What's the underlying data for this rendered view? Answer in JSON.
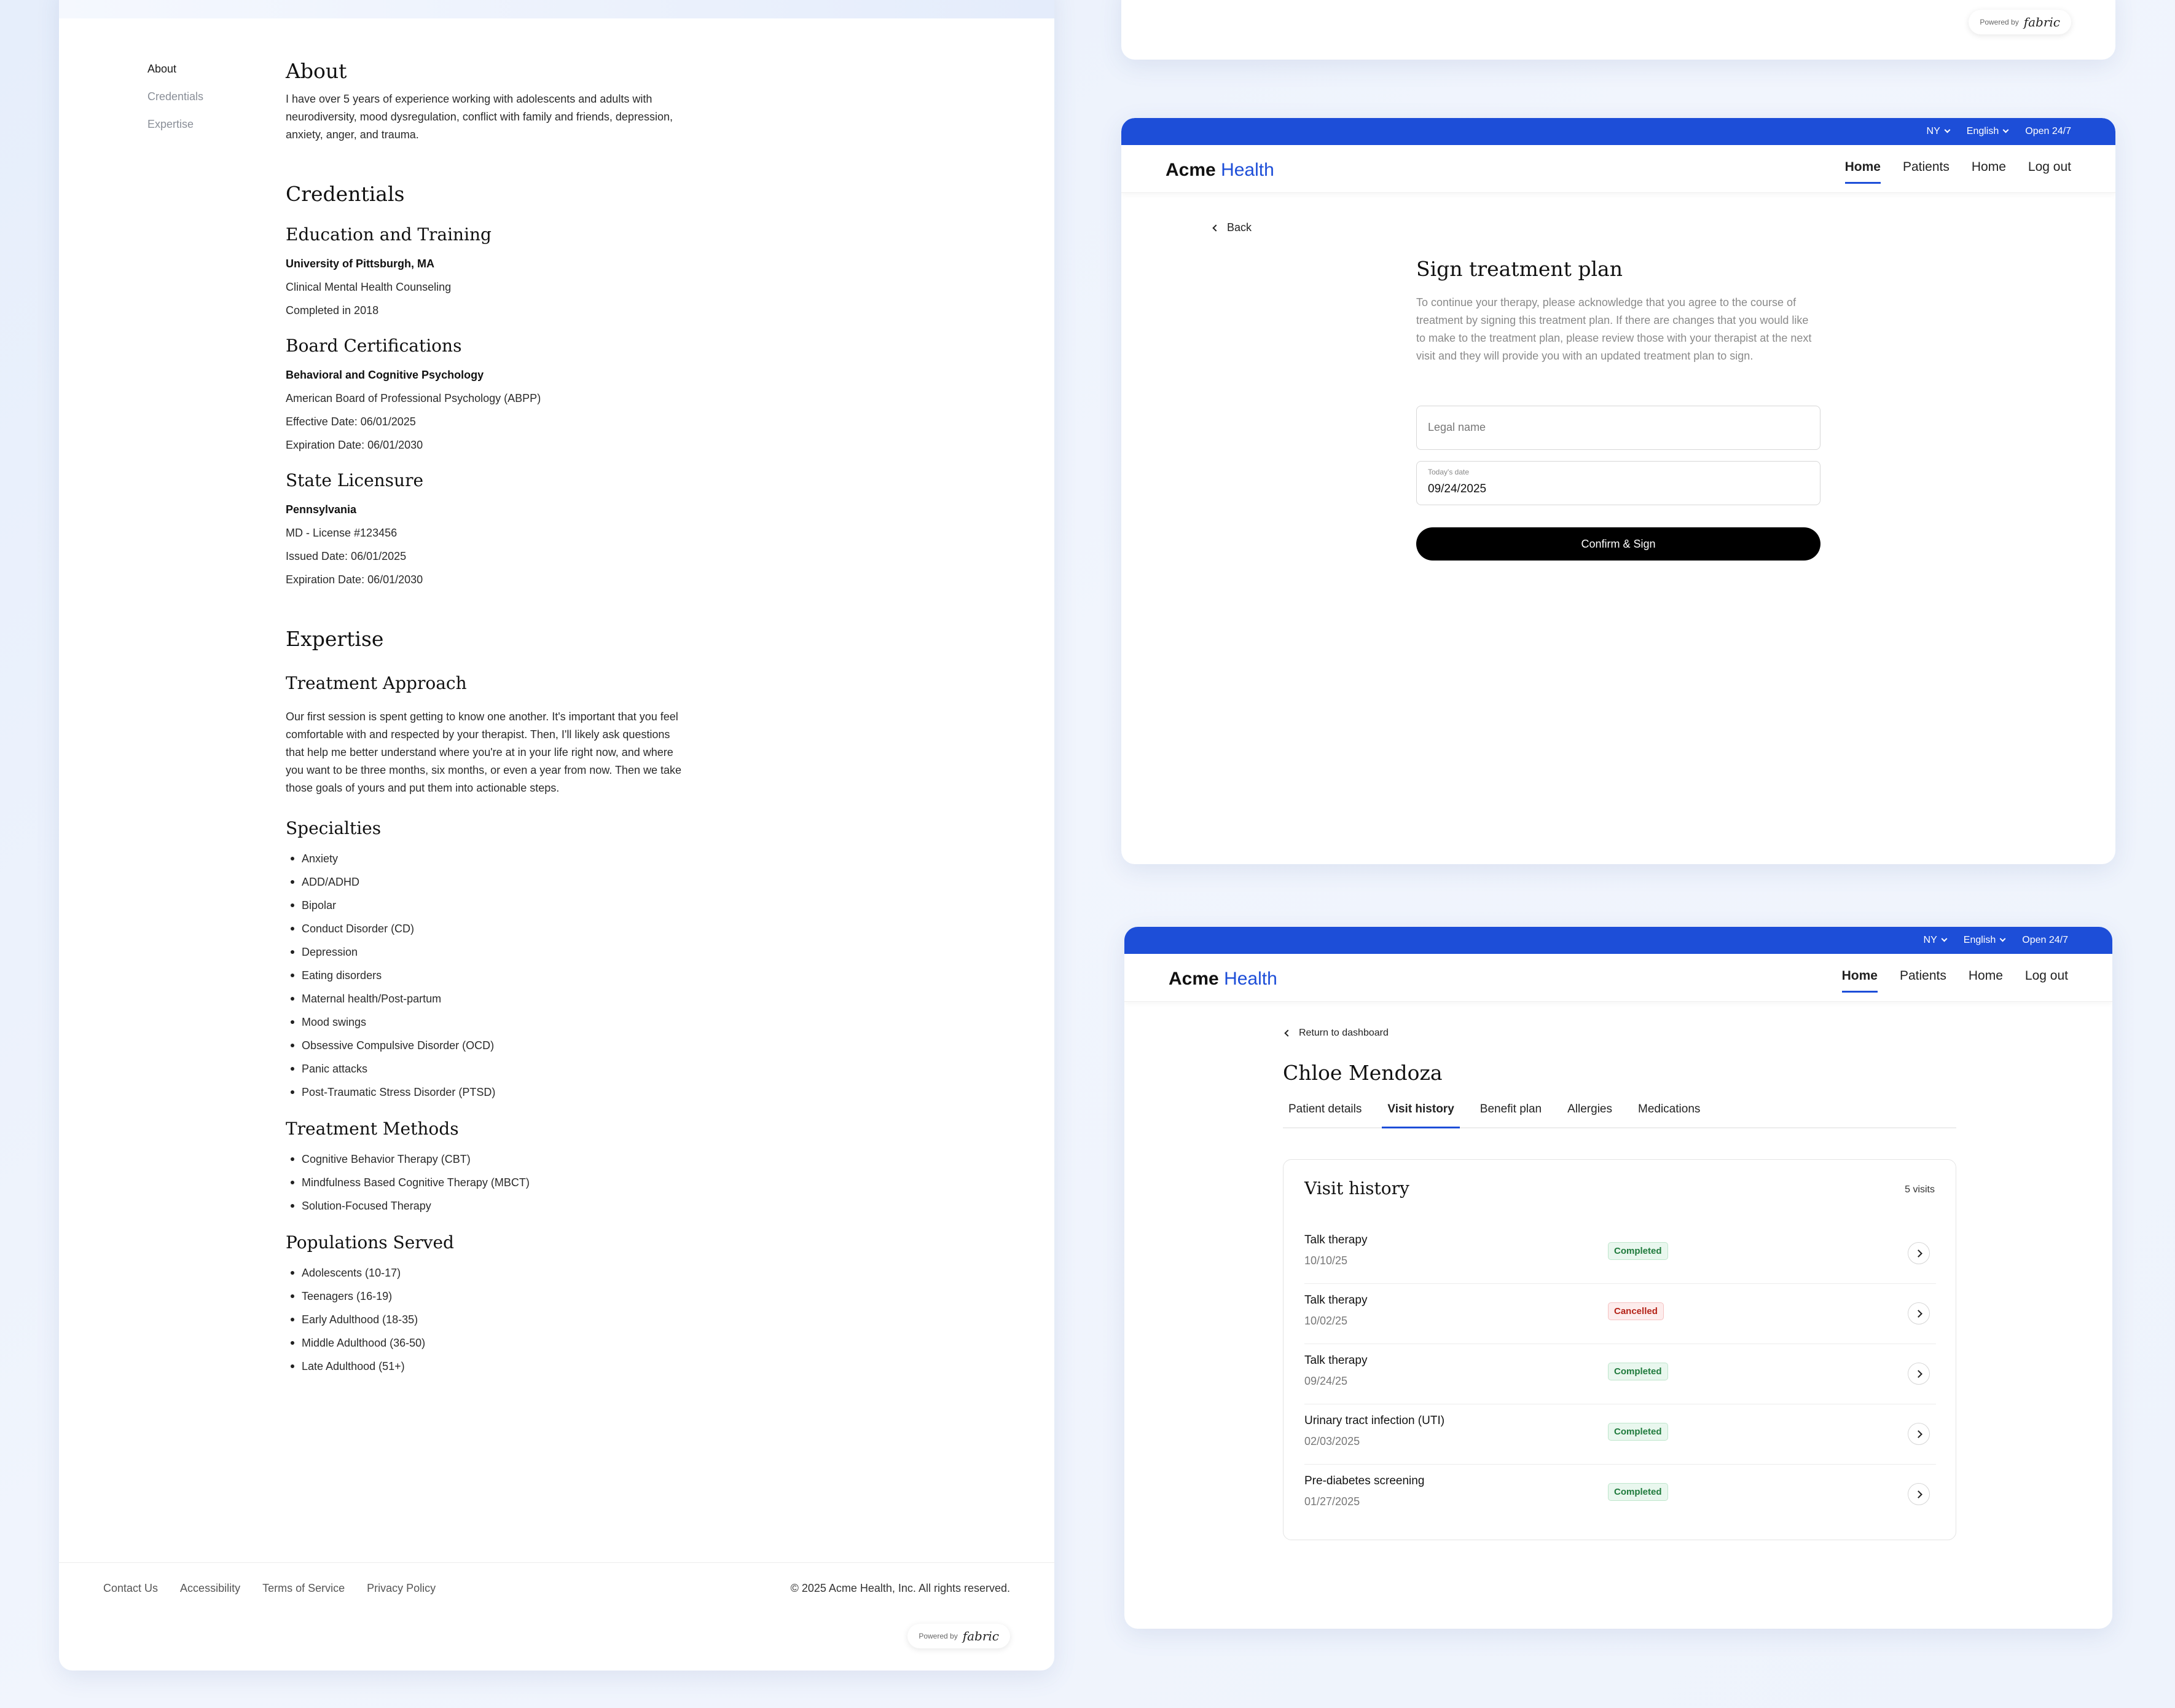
{
  "profile": {
    "nav": [
      "About",
      "Credentials",
      "Expertise"
    ],
    "about_title": "About",
    "about_text": "I have over 5 years of experience working with adolescents and adults with neurodiversity, mood dysregulation, conflict with family and friends, depression, anxiety, anger, and trauma.",
    "credentials_title": "Credentials",
    "education_title": "Education and Training",
    "education": [
      "University of Pittsburgh, MA",
      "Clinical Mental Health Counseling",
      "Completed in 2018"
    ],
    "board_title": "Board Certifications",
    "board": [
      "Behavioral and Cognitive Psychology",
      "American Board of Professional Psychology (ABPP)",
      "Effective Date: 06/01/2025",
      "Expiration Date: 06/01/2030"
    ],
    "licensure_title": "State Licensure",
    "licensure": [
      "Pennsylvania",
      "MD - License #123456",
      "Issued Date: 06/01/2025",
      "Expiration Date: 06/01/2030"
    ],
    "expertise_title": "Expertise",
    "approach_title": "Treatment Approach",
    "approach_text": "Our first session is spent getting to know one another. It's important that you feel comfortable with and respected by your therapist. Then, I'll likely ask questions that help me better understand where you're at in your life right now, and where you want to be three months, six months, or even a year from now. Then we take those goals of yours and put them into actionable steps.",
    "specialties_title": "Specialties",
    "specialties": [
      "Anxiety",
      "ADD/ADHD",
      "Bipolar",
      "Conduct Disorder (CD)",
      "Depression",
      "Eating disorders",
      "Maternal health/Post-partum",
      "Mood swings",
      "Obsessive Compulsive Disorder (OCD)",
      "Panic attacks",
      "Post-Traumatic Stress Disorder (PTSD)"
    ],
    "methods_title": "Treatment Methods",
    "methods": [
      "Cognitive Behavior Therapy (CBT)",
      "Mindfulness Based Cognitive Therapy (MBCT)",
      "Solution-Focused Therapy"
    ],
    "populations_title": "Populations Served",
    "populations": [
      "Adolescents (10-17)",
      "Teenagers (16-19)",
      "Early Adulthood (18-35)",
      "Middle Adulthood (36-50)",
      "Late Adulthood (51+)"
    ],
    "footer_links": [
      "Contact Us",
      "Accessibility",
      "Terms of Service",
      "Privacy Policy"
    ],
    "copyright": "© 2025 Acme Health, Inc. All rights reserved."
  },
  "powered": {
    "prefix": "Powered by",
    "brand": "fabric"
  },
  "header": {
    "region": "NY",
    "language": "English",
    "hours": "Open 24/7",
    "logo_bold": "Acme",
    "logo_rest": "Health",
    "nav": [
      "Home",
      "Patients",
      "Home",
      "Log out"
    ]
  },
  "sign": {
    "back": "Back",
    "title": "Sign treatment plan",
    "description": "To continue your therapy, please acknowledge that you agree to the course of treatment by signing this treatment plan. If there are changes that you would like to make to the treatment plan, please review those with your therapist at the next visit and they will provide you with an updated treatment plan to sign.",
    "legal_name_placeholder": "Legal name",
    "date_label": "Today's date",
    "date_value": "09/24/2025",
    "confirm": "Confirm & Sign"
  },
  "patient": {
    "back": "Return to dashboard",
    "name": "Chloe Mendoza",
    "tabs": [
      "Patient details",
      "Visit history",
      "Benefit plan",
      "Allergies",
      "Medications"
    ],
    "active_tab": 1,
    "visit_title": "Visit history",
    "visit_count": "5 visits",
    "visits": [
      {
        "title": "Talk therapy",
        "date": "10/10/25",
        "status": "Completed"
      },
      {
        "title": "Talk therapy",
        "date": "10/02/25",
        "status": "Cancelled"
      },
      {
        "title": "Talk therapy",
        "date": "09/24/25",
        "status": "Completed"
      },
      {
        "title": "Urinary tract infection (UTI)",
        "date": "02/03/2025",
        "status": "Completed"
      },
      {
        "title": "Pre-diabetes screening",
        "date": "01/27/2025",
        "status": "Completed"
      }
    ]
  },
  "colors": {
    "brand_blue": "#1d4ed8",
    "completed": "#1f7a3c",
    "cancelled": "#b42318"
  }
}
